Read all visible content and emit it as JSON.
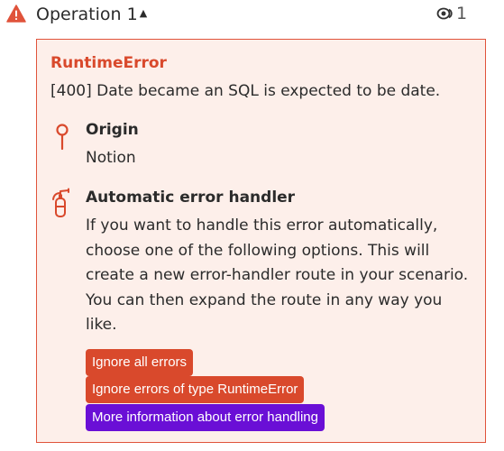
{
  "operation": {
    "title": "Operation 1",
    "caret_icon": "caret-up-icon",
    "warning_icon": "warning-triangle-icon",
    "warning_color": "#e0533b",
    "bundle_icon": "eye-bundle-icon",
    "bundle_count": "1"
  },
  "error": {
    "type": "RuntimeError",
    "message": "[400] Date became an SQL is expected to be date.",
    "accent_color": "#d9492c",
    "panel_background": "#fdefea",
    "origin": {
      "icon": "pin-icon",
      "heading": "Origin",
      "value": "Notion"
    },
    "handler": {
      "icon": "fire-extinguisher-icon",
      "heading": "Automatic error handler",
      "description_lines": [
        "If you want to handle this error automatically,",
        "choose one of the following options. This will",
        "create a new error-handler route in your scenario.",
        "You can then expand the route in any way you",
        "like."
      ]
    },
    "actions": {
      "ignore_all": "Ignore all errors",
      "ignore_type": "Ignore errors of type RuntimeError",
      "more_info": "More information about error handling",
      "primary_color": "#d9492c",
      "info_color": "#6a0fd6"
    }
  }
}
